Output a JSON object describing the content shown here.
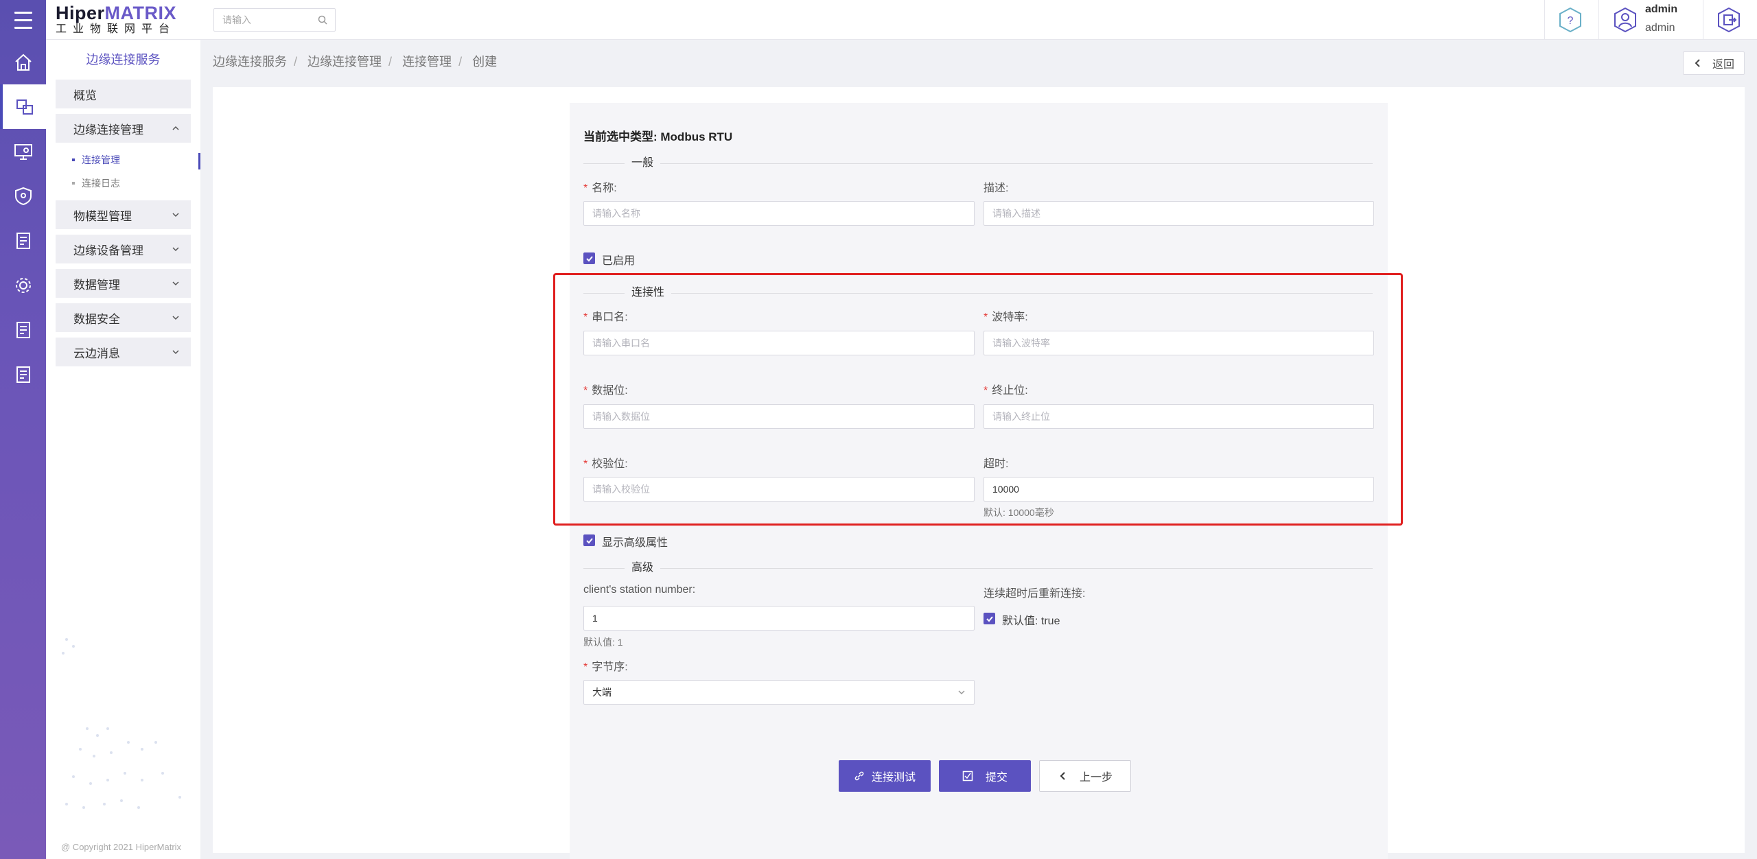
{
  "header": {
    "logo_main_a": "Hiper",
    "logo_main_b": "MATRIX",
    "logo_sub": "工业物联网平台",
    "search_placeholder": "请输入",
    "user_name": "admin",
    "user_role": "admin"
  },
  "rail": {
    "icons": [
      "home-icon",
      "edge-connect-icon",
      "monitor-icon",
      "shield-icon",
      "doc-icon",
      "settings-gear-icon",
      "doc-icon",
      "doc-icon"
    ]
  },
  "sidebar": {
    "title": "边缘连接服务",
    "overview": "概览",
    "edge_conn_mgmt": "边缘连接管理",
    "sub_conn_mgmt": "连接管理",
    "sub_conn_log": "连接日志",
    "model_mgmt": "物模型管理",
    "device_mgmt": "边缘设备管理",
    "data_mgmt": "数据管理",
    "data_security": "数据安全",
    "cloud_edge_msg": "云边消息",
    "copyright": "@ Copyright 2021 HiperMatrix"
  },
  "breadcrumb": [
    "边缘连接服务",
    "边缘连接管理",
    "连接管理",
    "创建"
  ],
  "back_label": "返回",
  "form": {
    "type_label": "当前选中类型:  Modbus RTU",
    "section_general": "一般",
    "name_label": "名称:",
    "name_placeholder": "请输入名称",
    "desc_label": "描述:",
    "desc_placeholder": "请输入描述",
    "enabled_label": "已启用",
    "section_connectivity": "连接性",
    "serial_label": "串口名:",
    "serial_placeholder": "请输入串口名",
    "baud_label": "波特率:",
    "baud_placeholder": "请输入波特率",
    "databits_label": "数据位:",
    "databits_placeholder": "请输入数据位",
    "stopbits_label": "终止位:",
    "stopbits_placeholder": "请输入终止位",
    "parity_label": "校验位:",
    "parity_placeholder": "请输入校验位",
    "timeout_label": "超时:",
    "timeout_value": "10000",
    "timeout_hint": "默认: 10000毫秒",
    "show_advanced_label": "显示高级属性",
    "section_advanced": "高级",
    "station_label": "client's station number:",
    "station_value": "1",
    "station_hint": "默认值: 1",
    "reconnect_label": "连续超时后重新连接:",
    "reconnect_default": "默认值: true",
    "byteorder_label": "字节序:",
    "byteorder_value": "大端"
  },
  "buttons": {
    "test": "连接测试",
    "submit": "提交",
    "prev": "上一步"
  },
  "colors": {
    "primary": "#5b52c0",
    "required": "#e53935",
    "highlight_box": "#e02020"
  }
}
